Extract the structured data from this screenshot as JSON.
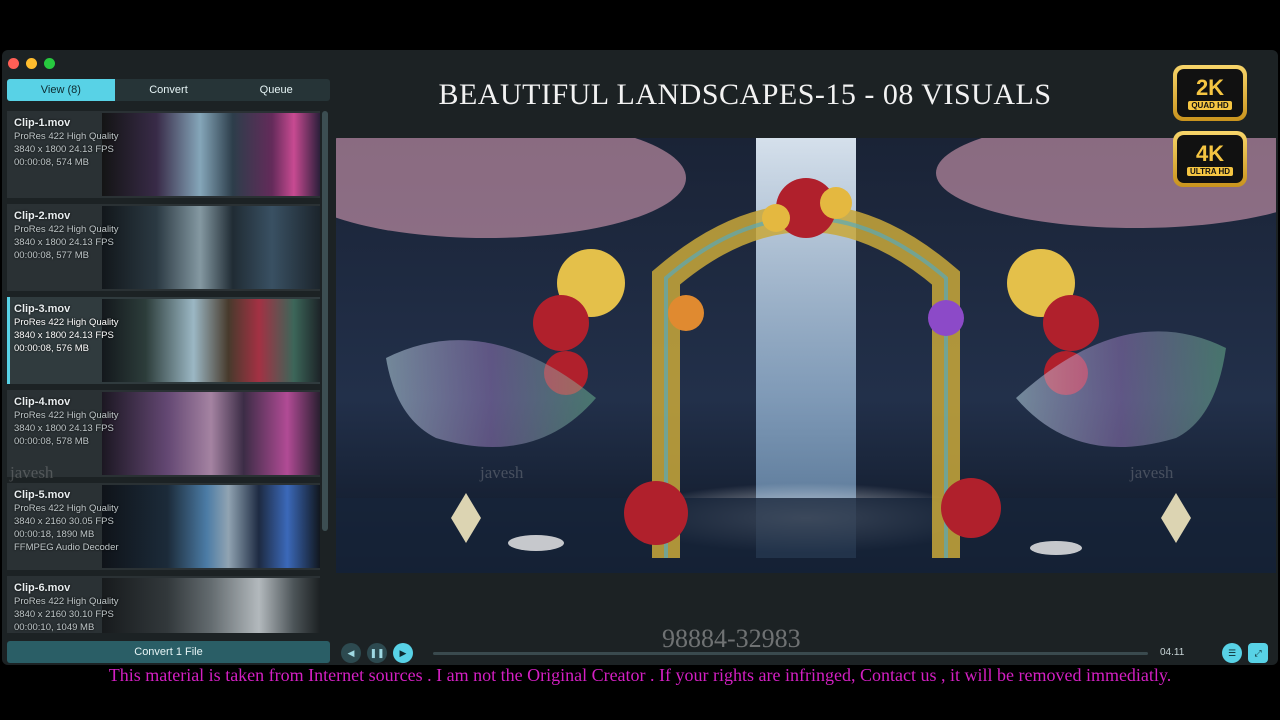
{
  "tabs": [
    {
      "label": "View (8)"
    },
    {
      "label": "Convert"
    },
    {
      "label": "Queue"
    }
  ],
  "clips": [
    {
      "name": "Clip-1.mov",
      "codec": "ProRes 422 High Quality",
      "specs": "3840 x 1800 24.13 FPS",
      "duration_size": "00:00:08, 574 MB",
      "extra": ""
    },
    {
      "name": "Clip-2.mov",
      "codec": "ProRes 422 High Quality",
      "specs": "3840 x 1800 24.13 FPS",
      "duration_size": "00:00:08, 577 MB",
      "extra": ""
    },
    {
      "name": "Clip-3.mov",
      "codec": "ProRes 422 High Quality",
      "specs": "3840 x 1800 24.13 FPS",
      "duration_size": "00:00:08, 576 MB",
      "extra": ""
    },
    {
      "name": "Clip-4.mov",
      "codec": "ProRes 422 High Quality",
      "specs": "3840 x 1800 24.13 FPS",
      "duration_size": "00:00:08, 578 MB",
      "extra": ""
    },
    {
      "name": "Clip-5.mov",
      "codec": "ProRes 422 High Quality",
      "specs": "3840 x 2160 30.05 FPS",
      "duration_size": "00:00:18, 1890 MB",
      "extra": "FFMPEG Audio Decoder"
    },
    {
      "name": "Clip-6.mov",
      "codec": "ProRes 422 High Quality",
      "specs": "3840 x 2160 30.10 FPS",
      "duration_size": "00:00:10, 1049 MB",
      "extra": ""
    }
  ],
  "convert_button": "Convert 1 File",
  "title": "BEAUTIFUL LANDSCAPES-15 - 08 VISUALS",
  "badges": [
    {
      "big": "2K",
      "small": "QUAD HD"
    },
    {
      "big": "4K",
      "small": "ULTRA HD"
    }
  ],
  "player": {
    "time": "04.11",
    "progress": 0.0
  },
  "overlay": {
    "phone": "98884-32983",
    "watermark": "javesh",
    "disclaimer": "This material is taken from Internet sources . I am not the Original Creator . If your rights are infringed, Contact us , it will be removed immediatly."
  },
  "colors": {
    "accent": "#58d2e6",
    "disclaimer": "#d41fc3"
  },
  "icons": [
    "prev-icon",
    "pause-icon",
    "play-icon",
    "list-icon",
    "fullscreen-icon"
  ]
}
